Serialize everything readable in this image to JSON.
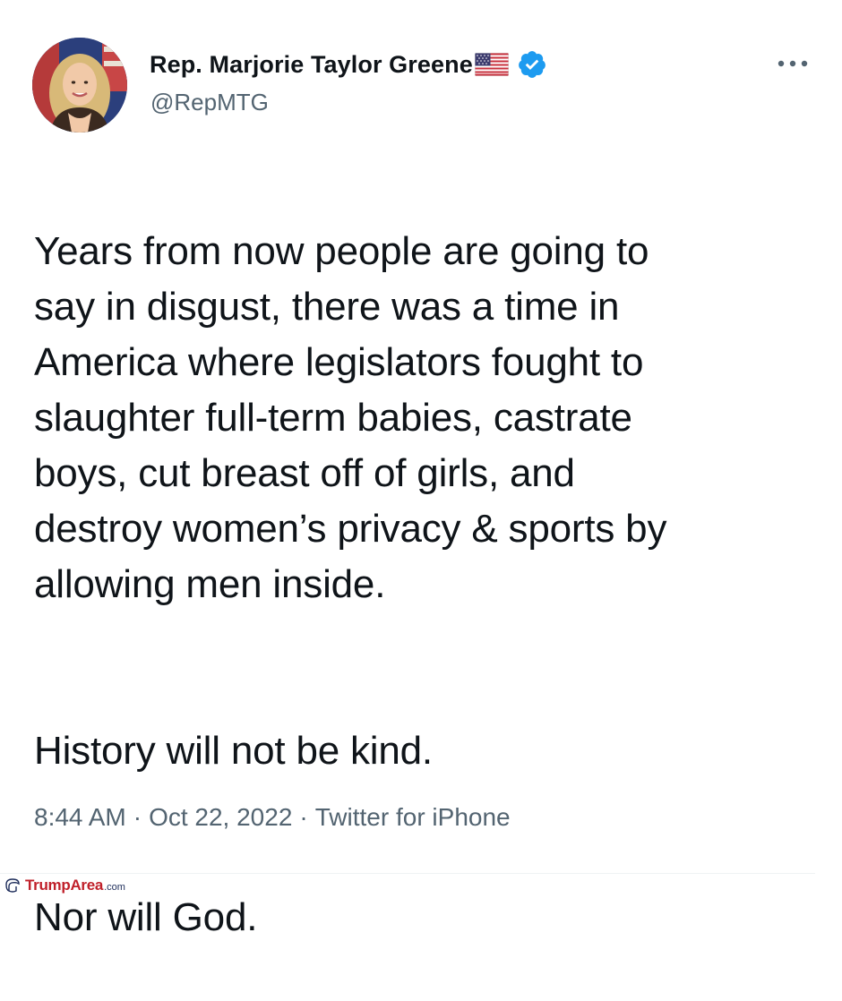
{
  "author": {
    "display_name": "Rep. Marjorie Taylor Greene",
    "handle": "@RepMTG",
    "flag_icon": "us-flag-emoji",
    "verified_icon": "verified-badge",
    "verified_color": "#1d9bf0"
  },
  "tweet": {
    "paragraphs": [
      "Years from now people are going to\nsay in disgust, there was a time in\nAmerica where legislators fought to\nslaughter full-term babies, castrate\nboys, cut breast off of girls, and\ndestroy women’s privacy & sports by\nallowing men inside.",
      "History will not be kind.",
      "Nor will God."
    ],
    "time": "8:44 AM",
    "date": "Oct 22, 2022",
    "separator": "·",
    "source": "Twitter for iPhone"
  },
  "more_icon": "more-horizontal-icon",
  "watermark": {
    "brand": "TrumpArea",
    "suffix": ".com",
    "icon": "hair-logo-icon"
  },
  "colors": {
    "text_primary": "#0f1419",
    "text_secondary": "#536471",
    "watermark_red": "#c0202a"
  }
}
